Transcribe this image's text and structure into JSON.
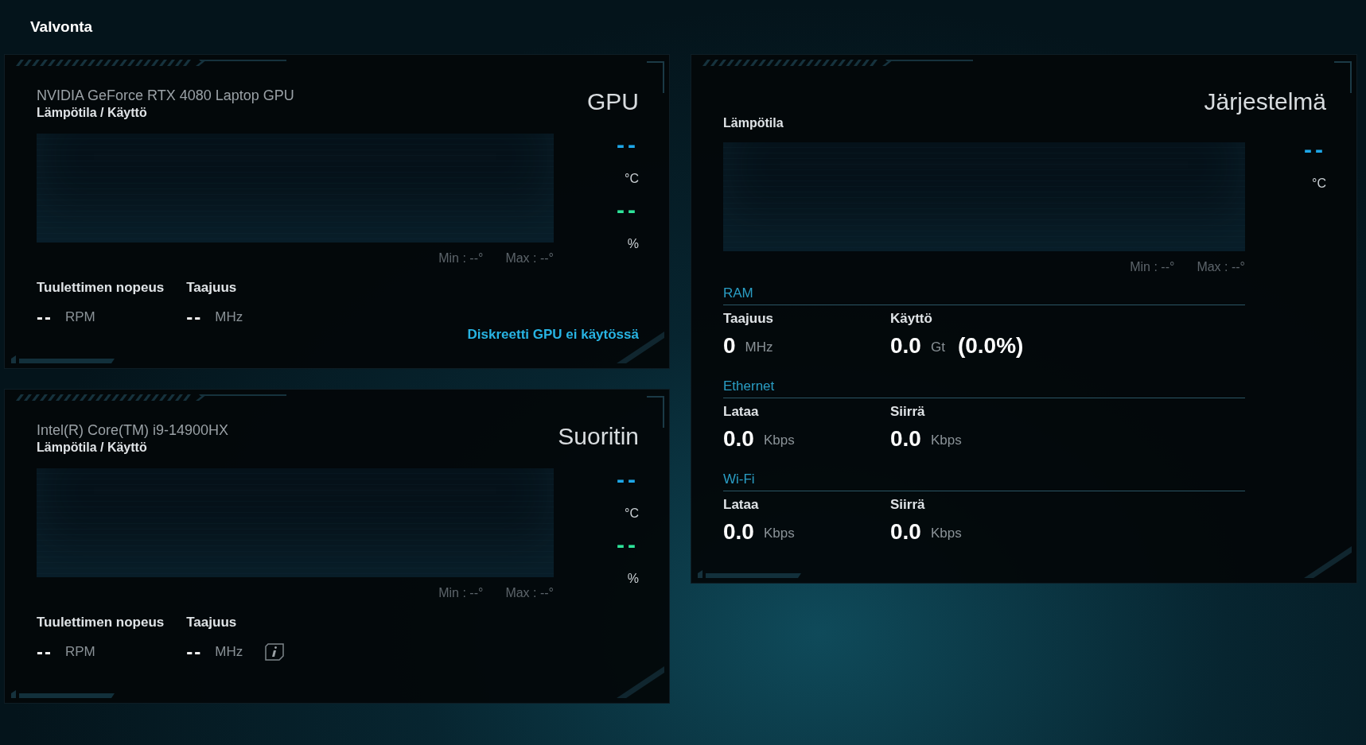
{
  "title": "Valvonta",
  "panels": [
    {
      "heading": "GPU",
      "device": "NVIDIA GeForce RTX 4080 Laptop GPU",
      "chart_label": "Lämpötila / Käyttö",
      "temp_value": "--",
      "temp_unit": "°C",
      "usage_value": "--",
      "usage_unit": "%",
      "min": "Min : --°",
      "max": "Max : --°",
      "stats": [
        {
          "label": "Tuulettimen nopeus",
          "value": "--",
          "unit": "RPM",
          "info": false
        },
        {
          "label": "Taajuus",
          "value": "--",
          "unit": "MHz",
          "info": false
        }
      ],
      "note": "Diskreetti GPU ei käytössä"
    },
    {
      "heading": "Suoritin",
      "device": "Intel(R) Core(TM) i9-14900HX",
      "chart_label": "Lämpötila / Käyttö",
      "temp_value": "--",
      "temp_unit": "°C",
      "usage_value": "--",
      "usage_unit": "%",
      "min": "Min : --°",
      "max": "Max : --°",
      "stats": [
        {
          "label": "Tuulettimen nopeus",
          "value": "--",
          "unit": "RPM",
          "info": false
        },
        {
          "label": "Taajuus",
          "value": "--",
          "unit": "MHz",
          "info": true
        }
      ]
    }
  ],
  "system": {
    "heading": "Järjestelmä",
    "chart_label": "Lämpötila",
    "temp_value": "--",
    "temp_unit": "°C",
    "min": "Min : --°",
    "max": "Max : --°",
    "sections": [
      {
        "title": "RAM",
        "items": [
          {
            "label": "Taajuus",
            "value": "0",
            "unit": "MHz"
          },
          {
            "label": "Käyttö",
            "value": "0.0",
            "unit": "Gt",
            "extra": "(0.0%)"
          }
        ]
      },
      {
        "title": "Ethernet",
        "items": [
          {
            "label": "Lataa",
            "value": "0.0",
            "unit": "Kbps"
          },
          {
            "label": "Siirrä",
            "value": "0.0",
            "unit": "Kbps"
          }
        ]
      },
      {
        "title": "Wi-Fi",
        "items": [
          {
            "label": "Lataa",
            "value": "0.0",
            "unit": "Kbps"
          },
          {
            "label": "Siirrä",
            "value": "0.0",
            "unit": "Kbps"
          }
        ]
      }
    ]
  }
}
